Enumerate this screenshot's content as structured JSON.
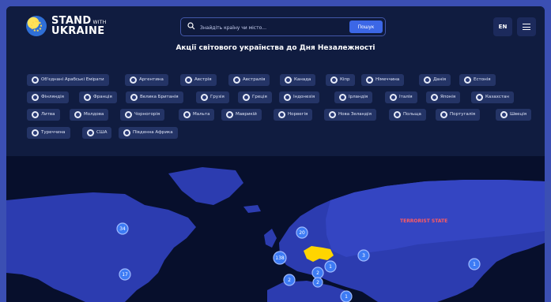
{
  "header": {
    "logo": {
      "line1": "STAND",
      "line1_small": "WITH",
      "line2": "UKRAINE"
    },
    "search": {
      "placeholder": "Знайдіть країну чи місто...",
      "value": "",
      "button_label": "Пошук"
    },
    "lang_label": "EN",
    "title": "Акції світового українства до Дня Незалежності"
  },
  "countries": [
    "Об'єднані Арабські Емірати",
    "Аргентина",
    "Австрія",
    "Австралія",
    "Канада",
    "Кіпр",
    "Німеччина",
    "Данія",
    "Естонія",
    "Фінляндія",
    "Франція",
    "Велика Британія",
    "Грузія",
    "Греція",
    "Індонезія",
    "Ірландія",
    "Італія",
    "Японія",
    "Казахстан",
    "Литва",
    "Молдова",
    "Чорногорія",
    "Мальта",
    "Маврикій",
    "Норвегія",
    "Нова Зеландія",
    "Польща",
    "Португалія",
    "Швеція",
    "Туреччина",
    "США",
    "Південна Африка"
  ],
  "map": {
    "terrorist_label": "TERRORIST STATE",
    "clusters": [
      {
        "label": "34"
      },
      {
        "label": "17"
      },
      {
        "label": "20"
      },
      {
        "label": "138"
      },
      {
        "label": "2"
      },
      {
        "label": "1"
      },
      {
        "label": "2"
      },
      {
        "label": "3"
      },
      {
        "label": "1"
      },
      {
        "label": "1"
      },
      {
        "label": "2"
      }
    ],
    "colors": {
      "land": "#2c3cb0",
      "ocean": "#070f2c",
      "ukraine": "#ffd500",
      "cluster": "#3d7bf4"
    }
  }
}
